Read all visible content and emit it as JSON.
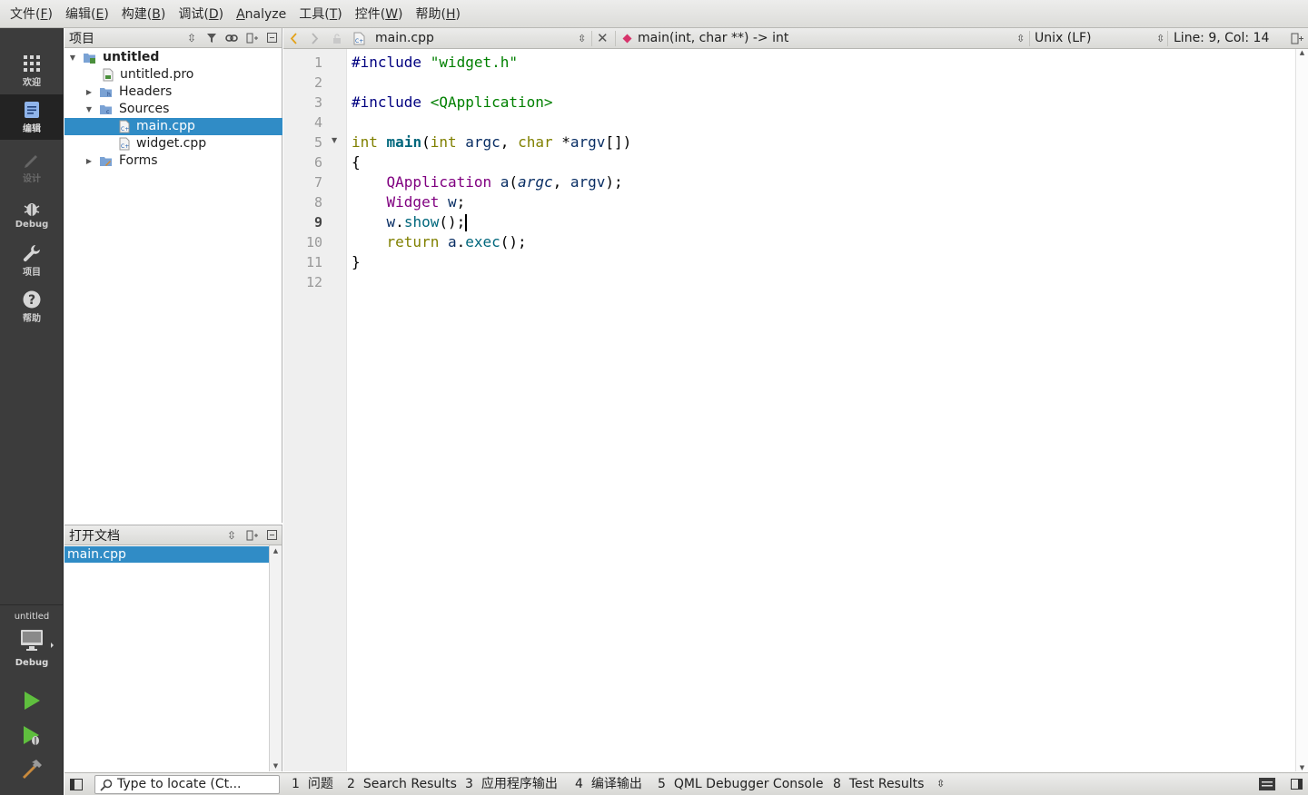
{
  "menubar": {
    "items": [
      {
        "label": "文件(",
        "key": "F",
        "tail": ")"
      },
      {
        "label": "编辑(",
        "key": "E",
        "tail": ")"
      },
      {
        "label": "构建(",
        "key": "B",
        "tail": ")"
      },
      {
        "label": "调试(",
        "key": "D",
        "tail": ")"
      },
      {
        "label": "",
        "key": "A",
        "tail": "nalyze"
      },
      {
        "label": "工具(",
        "key": "T",
        "tail": ")"
      },
      {
        "label": "控件(",
        "key": "W",
        "tail": ")"
      },
      {
        "label": "帮助(",
        "key": "H",
        "tail": ")"
      }
    ]
  },
  "modes": {
    "welcome": "欢迎",
    "edit": "编辑",
    "design": "设计",
    "debug": "Debug",
    "projects": "项目",
    "help": "帮助"
  },
  "kit": {
    "project": "untitled",
    "build": "Debug"
  },
  "project_pane": {
    "title": "项目",
    "tree": {
      "root": "untitled",
      "pro": "untitled.pro",
      "headers": "Headers",
      "sources": "Sources",
      "main": "main.cpp",
      "widget": "widget.cpp",
      "forms": "Forms"
    }
  },
  "open_docs": {
    "title": "打开文档",
    "items": [
      "main.cpp"
    ]
  },
  "editor_toolbar": {
    "file": "main.cpp",
    "symbol": "main(int, char **) -> int",
    "line_ending": "Unix (LF)",
    "position": "Line: 9, Col: 14"
  },
  "editor": {
    "current_line": 9,
    "line_numbers": [
      "1",
      "2",
      "3",
      "4",
      "5",
      "6",
      "7",
      "8",
      "9",
      "10",
      "11",
      "12"
    ]
  },
  "statusbar": {
    "locator_placeholder": "Type to locate (Ct...",
    "panes": [
      {
        "num": "1",
        "label": "问题"
      },
      {
        "num": "2",
        "label": "Search Results"
      },
      {
        "num": "3",
        "label": "应用程序输出"
      },
      {
        "num": "4",
        "label": "编译输出"
      },
      {
        "num": "5",
        "label": "QML Debugger Console"
      },
      {
        "num": "8",
        "label": "Test Results"
      }
    ]
  }
}
